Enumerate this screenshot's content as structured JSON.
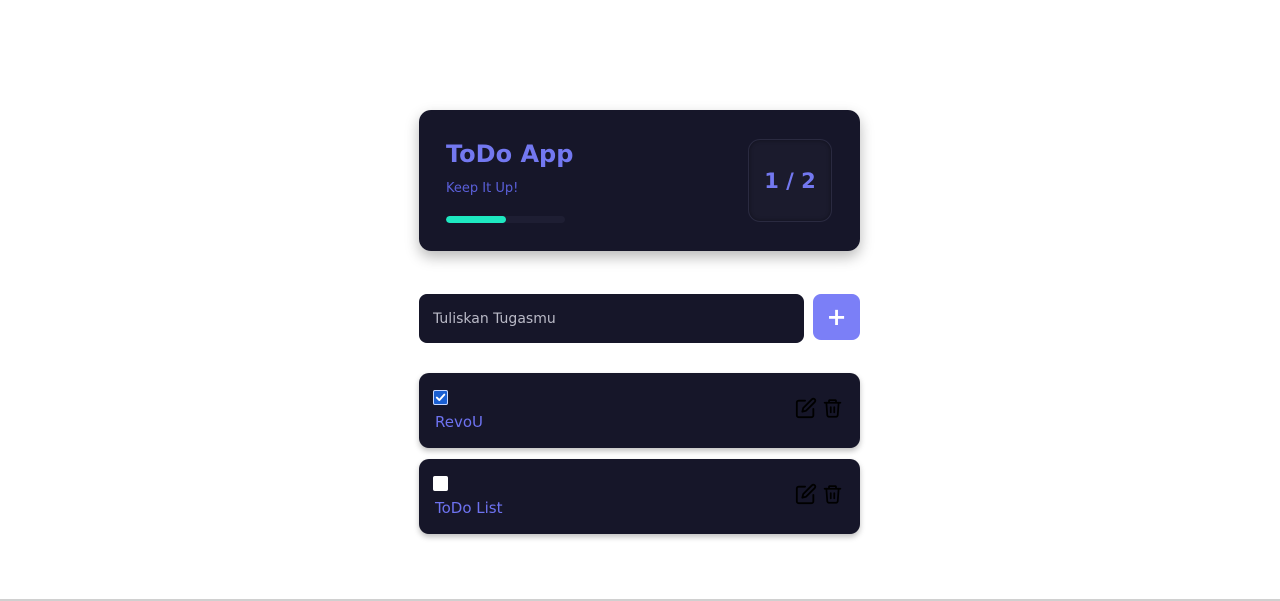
{
  "header": {
    "title": "ToDo App",
    "subtitle": "Keep It Up!",
    "progress_fraction": 0.5,
    "counter": "1 / 2"
  },
  "input": {
    "placeholder": "Tuliskan Tugasmu",
    "value": ""
  },
  "add_button": {
    "label": "+"
  },
  "todos": [
    {
      "label": "RevoU",
      "checked": true
    },
    {
      "label": "ToDo List",
      "checked": false
    }
  ],
  "icons": {
    "edit": "edit-icon",
    "delete": "trash-icon",
    "check": "check-icon"
  },
  "colors": {
    "card_bg": "#161629",
    "accent": "#7378f0",
    "button_bg": "#7b7ff7",
    "progress": "#1ee8c1",
    "checkbox_checked": "#1a5fd1"
  }
}
